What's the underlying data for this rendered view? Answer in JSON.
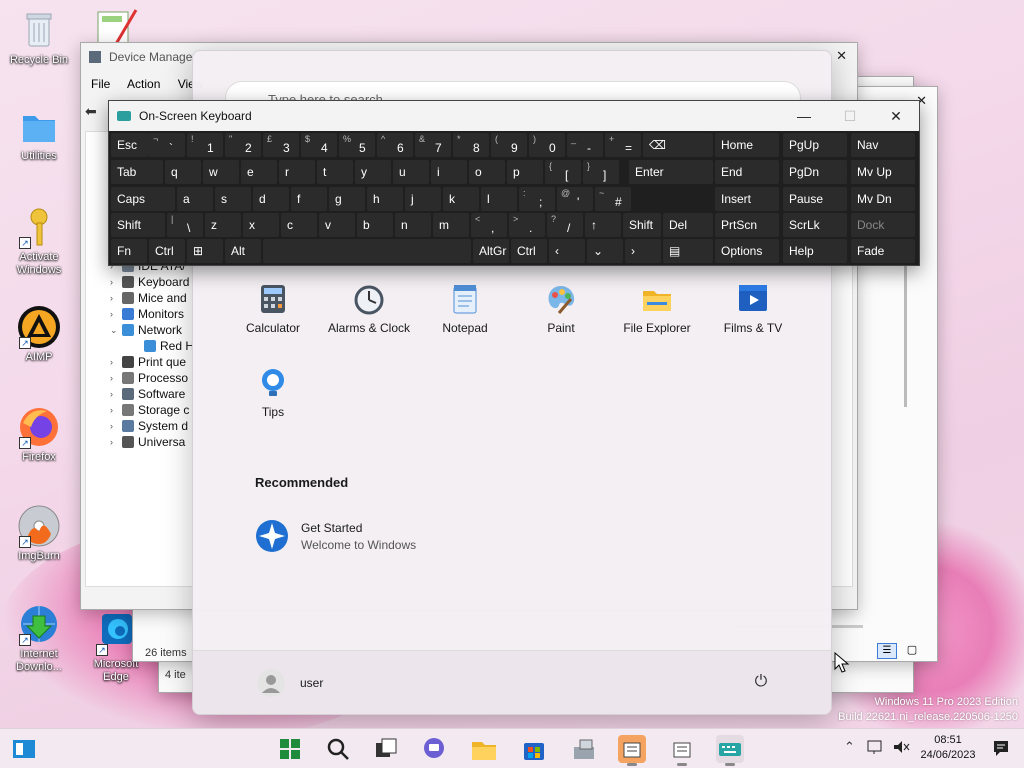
{
  "desktop": {
    "icons": [
      {
        "label": "Recycle Bin"
      },
      {
        "label": "Utilities"
      },
      {
        "label": "Activate Windows"
      },
      {
        "label": "AIMP"
      },
      {
        "label": "Firefox"
      },
      {
        "label": "ImgBurn"
      },
      {
        "label": "Internet Downlo..."
      },
      {
        "label": "Microsoft Edge"
      }
    ],
    "watermark": {
      "line1": "Windows 11 Pro 2023 Edition",
      "line2": "Build 22621.ni_release.220506-1250"
    }
  },
  "device_manager": {
    "title": "Device Manager",
    "menu": [
      "File",
      "Action",
      "View"
    ],
    "tree": [
      {
        "arrow": "›",
        "label": "IDE ATA/"
      },
      {
        "arrow": "›",
        "label": "Keyboard"
      },
      {
        "arrow": "›",
        "label": "Mice and"
      },
      {
        "arrow": "›",
        "label": "Monitors"
      },
      {
        "arrow": "⌄",
        "label": "Network"
      },
      {
        "arrow": "",
        "label": "Red H"
      },
      {
        "arrow": "›",
        "label": "Print que"
      },
      {
        "arrow": "›",
        "label": "Processo"
      },
      {
        "arrow": "›",
        "label": "Software"
      },
      {
        "arrow": "›",
        "label": "Storage c"
      },
      {
        "arrow": "›",
        "label": "System d"
      },
      {
        "arrow": "›",
        "label": "Universa"
      }
    ]
  },
  "explorer": {
    "status_items": "26 items",
    "status_items2": "4 ite"
  },
  "start_menu": {
    "search_placeholder": "Type here to search",
    "apps": [
      {
        "label": "Calculator"
      },
      {
        "label": "Alarms & Clock"
      },
      {
        "label": "Notepad"
      },
      {
        "label": "Paint"
      },
      {
        "label": "File Explorer"
      },
      {
        "label": "Films & TV"
      },
      {
        "label": "Tips"
      }
    ],
    "recommended_heading": "Recommended",
    "recommended": [
      {
        "title": "Get Started",
        "subtitle": "Welcome to Windows"
      }
    ],
    "user": "user"
  },
  "osk": {
    "title": "On-Screen Keyboard",
    "rows": [
      [
        "Esc",
        "¬ `",
        "! 1",
        "\" 2",
        "£ 3",
        "$ 4",
        "% 5",
        "^ 6",
        "& 7",
        "* 8",
        "( 9",
        ") 0",
        "_ -",
        "+ =",
        "⌫"
      ],
      [
        "Tab",
        "q",
        "w",
        "e",
        "r",
        "t",
        "y",
        "u",
        "i",
        "o",
        "p",
        "{ [",
        "} ]",
        "Enter"
      ],
      [
        "Caps",
        "a",
        "s",
        "d",
        "f",
        "g",
        "h",
        "j",
        "k",
        "l",
        ": ;",
        "@ '",
        "~ #"
      ],
      [
        "Shift",
        "| \\",
        "z",
        "x",
        "c",
        "v",
        "b",
        "n",
        "m",
        "< ,",
        "> .",
        "? /",
        "↑",
        "Shift",
        "Del"
      ],
      [
        "Fn",
        "Ctrl",
        "⊞",
        "Alt",
        "",
        "AltGr",
        "Ctrl",
        "‹",
        "⌄",
        "›",
        "▤"
      ]
    ],
    "nav_keys": [
      [
        "Home",
        "PgUp",
        "Nav"
      ],
      [
        "End",
        "PgDn",
        "Mv Up"
      ],
      [
        "Insert",
        "Pause",
        "Mv Dn"
      ],
      [
        "PrtScn",
        "ScrLk",
        "Dock"
      ],
      [
        "Options",
        "Help",
        "Fade"
      ]
    ]
  },
  "taskbar": {
    "time": "08:51",
    "date": "24/06/2023"
  }
}
